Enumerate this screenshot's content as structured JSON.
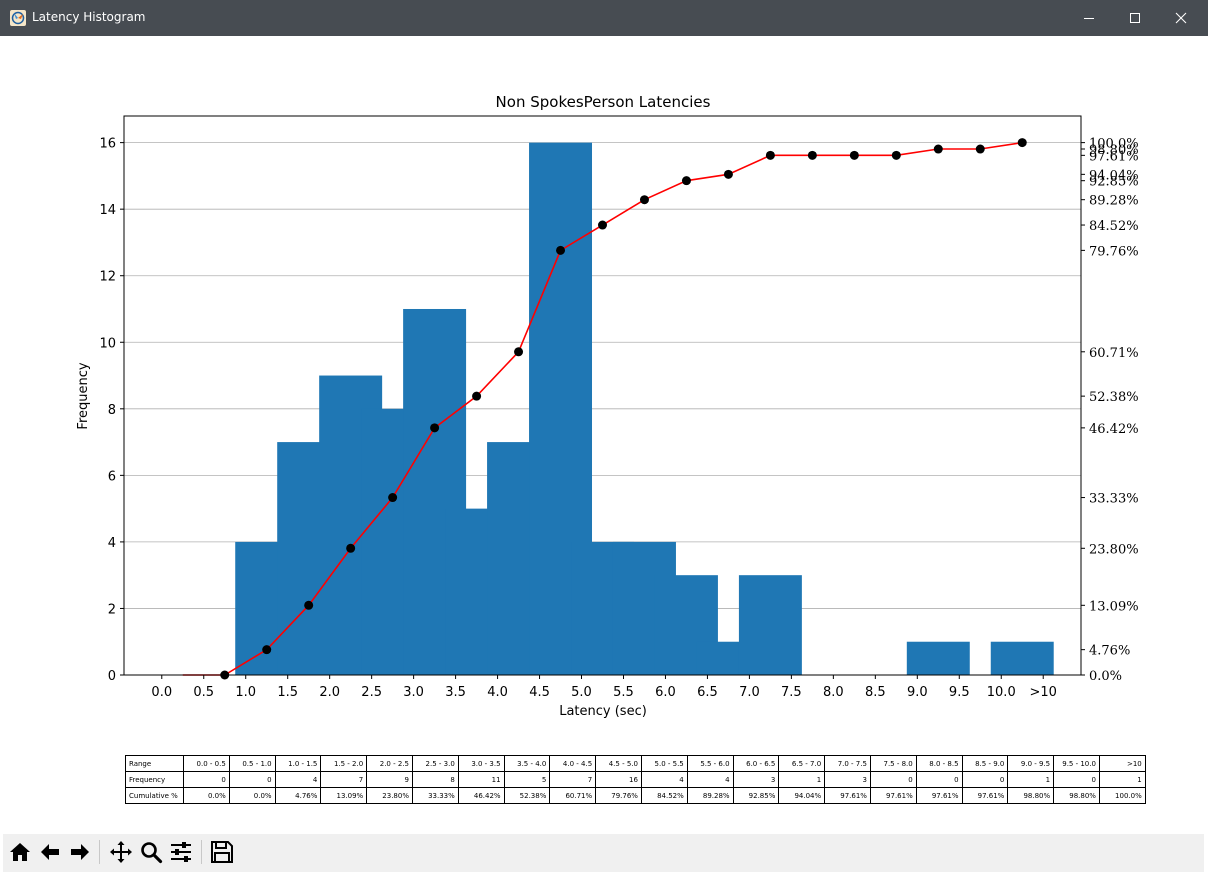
{
  "window": {
    "title": "Latency Histogram",
    "icon": "matplotlib-icon"
  },
  "controls": {
    "minimize": "minimize-icon",
    "maximize": "maximize-icon",
    "close": "close-icon"
  },
  "chart_data": {
    "type": "bar",
    "title": "Non SpokesPerson Latencies",
    "xlabel": "Latency (sec)",
    "ylabel": "Frequency",
    "ylim": [
      0,
      16.8
    ],
    "grid": "horizontal",
    "bar_color": "#1f77b4",
    "line_color": "#ff0000",
    "marker_color": "#000000",
    "x_ticks": [
      "0.0",
      "0.5",
      "1.0",
      "1.5",
      "2.0",
      "2.5",
      "3.0",
      "3.5",
      "4.0",
      "4.5",
      "5.0",
      "5.5",
      "6.0",
      "6.5",
      "7.0",
      "7.5",
      "8.0",
      "8.5",
      "9.0",
      "9.5",
      "10.0",
      ">10"
    ],
    "y_ticks": [
      0,
      2,
      4,
      6,
      8,
      10,
      12,
      14,
      16
    ],
    "categories": [
      "0.0 - 0.5",
      "0.5 - 1.0",
      "1.0 - 1.5",
      "1.5 - 2.0",
      "2.0 - 2.5",
      "2.5 - 3.0",
      "3.0 - 3.5",
      "3.5 - 4.0",
      "4.0 - 4.5",
      "4.5 - 5.0",
      "5.0 - 5.5",
      "5.5 - 6.0",
      "6.0 - 6.5",
      "6.5 - 7.0",
      "7.0 - 7.5",
      "7.5 - 8.0",
      "8.0 - 8.5",
      "8.5 - 9.0",
      "9.0 - 9.5",
      "9.5 - 10.0",
      ">10"
    ],
    "bar_centers": [
      0.25,
      0.75,
      1.25,
      1.75,
      2.25,
      2.75,
      3.25,
      3.75,
      4.25,
      4.75,
      5.25,
      5.75,
      6.25,
      6.75,
      7.25,
      7.75,
      8.25,
      8.75,
      9.25,
      9.75,
      10.25
    ],
    "bar_values": [
      0,
      0,
      4,
      7,
      9,
      8,
      11,
      5,
      7,
      16,
      4,
      4,
      3,
      1,
      3,
      0,
      0,
      0,
      1,
      0,
      1
    ],
    "cumulative_pct": [
      0.0,
      0.0,
      4.76,
      13.09,
      23.8,
      33.33,
      46.42,
      52.38,
      60.71,
      79.76,
      84.52,
      89.28,
      92.85,
      94.04,
      97.61,
      97.61,
      97.61,
      97.61,
      98.8,
      98.8,
      100.0
    ],
    "cumulative_start_x": 0.25,
    "cumulative_marker_x": [
      0.75,
      1.25,
      1.75,
      2.25,
      2.75,
      3.25,
      3.75,
      4.25,
      4.75,
      5.25,
      5.75,
      6.25,
      6.75,
      7.25,
      7.75,
      8.25,
      8.75,
      9.25,
      9.75,
      10.25
    ],
    "right_labels": [
      "100.0%",
      "98.80%",
      "97.61%",
      "94.04%",
      "92.85%",
      "89.28%",
      "84.52%",
      "79.76%",
      "60.71%",
      "52.38%",
      "46.42%",
      "33.33%",
      "23.80%",
      "13.09%",
      "4.76%",
      "0.0%"
    ],
    "right_values": [
      100.0,
      98.8,
      97.61,
      94.04,
      92.85,
      89.28,
      84.52,
      79.76,
      60.71,
      52.38,
      46.42,
      33.33,
      23.8,
      13.09,
      4.76,
      0.0
    ]
  },
  "table": {
    "row_headers": [
      "Range",
      "Frequency",
      "Cumulative %"
    ],
    "ranges": [
      "0.0 - 0.5",
      "0.5 - 1.0",
      "1.0 - 1.5",
      "1.5 - 2.0",
      "2.0 - 2.5",
      "2.5 - 3.0",
      "3.0 - 3.5",
      "3.5 - 4.0",
      "4.0 - 4.5",
      "4.5 - 5.0",
      "5.0 - 5.5",
      "5.5 - 6.0",
      "6.0 - 6.5",
      "6.5 - 7.0",
      "7.0 - 7.5",
      "7.5 - 8.0",
      "8.0 - 8.5",
      "8.5 - 9.0",
      "9.0 - 9.5",
      "9.5 - 10.0",
      ">10"
    ],
    "frequency": [
      "0",
      "0",
      "4",
      "7",
      "9",
      "8",
      "11",
      "5",
      "7",
      "16",
      "4",
      "4",
      "3",
      "1",
      "3",
      "0",
      "0",
      "0",
      "1",
      "0",
      "1"
    ],
    "cumulative": [
      "0.0%",
      "0.0%",
      "4.76%",
      "13.09%",
      "23.80%",
      "33.33%",
      "46.42%",
      "52.38%",
      "60.71%",
      "79.76%",
      "84.52%",
      "89.28%",
      "92.85%",
      "94.04%",
      "97.61%",
      "97.61%",
      "97.61%",
      "97.61%",
      "98.80%",
      "98.80%",
      "100.0%"
    ]
  },
  "toolbar": [
    "home-icon",
    "back-arrow-icon",
    "forward-arrow-icon",
    "pan-icon",
    "zoom-icon",
    "configure-subplots-icon",
    "save-icon"
  ]
}
